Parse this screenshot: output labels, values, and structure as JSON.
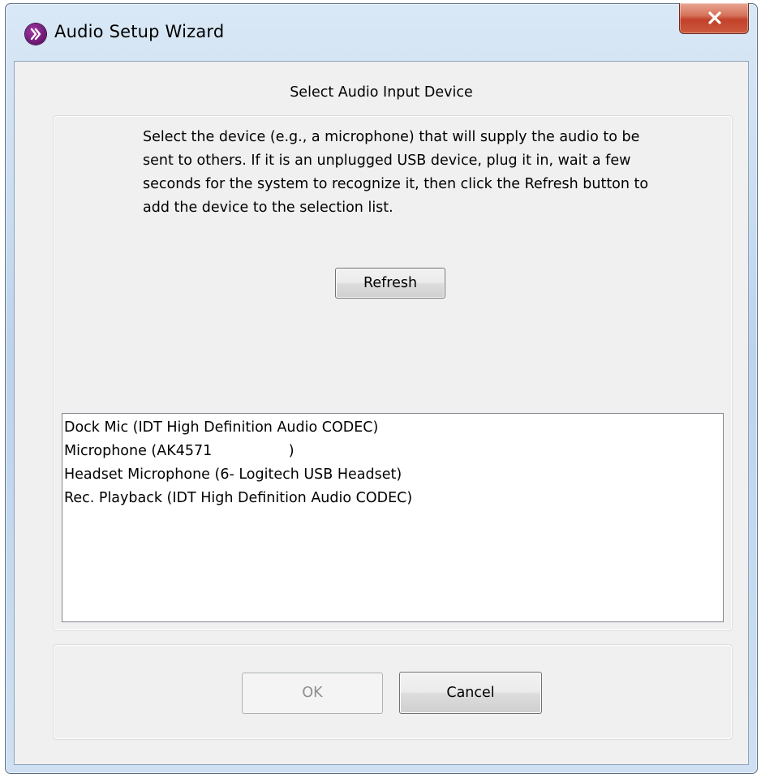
{
  "window": {
    "title": "Audio Setup Wizard",
    "icon": "forward-chevron-icon",
    "close_icon": "close-x-icon",
    "accent_close": "#c2412a"
  },
  "main": {
    "heading": "Select Audio Input Device",
    "instructions": "Select the device (e.g., a microphone) that will supply the audio to be sent to others. If it is an unplugged USB device, plug it in, wait a few seconds for the system to recognize it, then click the Refresh button to add the device to the selection list.",
    "refresh_label": "Refresh",
    "devices": [
      "Dock Mic (IDT High Definition Audio CODEC)",
      "Microphone (AK4571                 )",
      "Headset Microphone (6- Logitech USB Headset)",
      "Rec. Playback (IDT High Definition Audio CODEC)"
    ]
  },
  "footer": {
    "ok_label": "OK",
    "ok_enabled": false,
    "cancel_label": "Cancel"
  }
}
